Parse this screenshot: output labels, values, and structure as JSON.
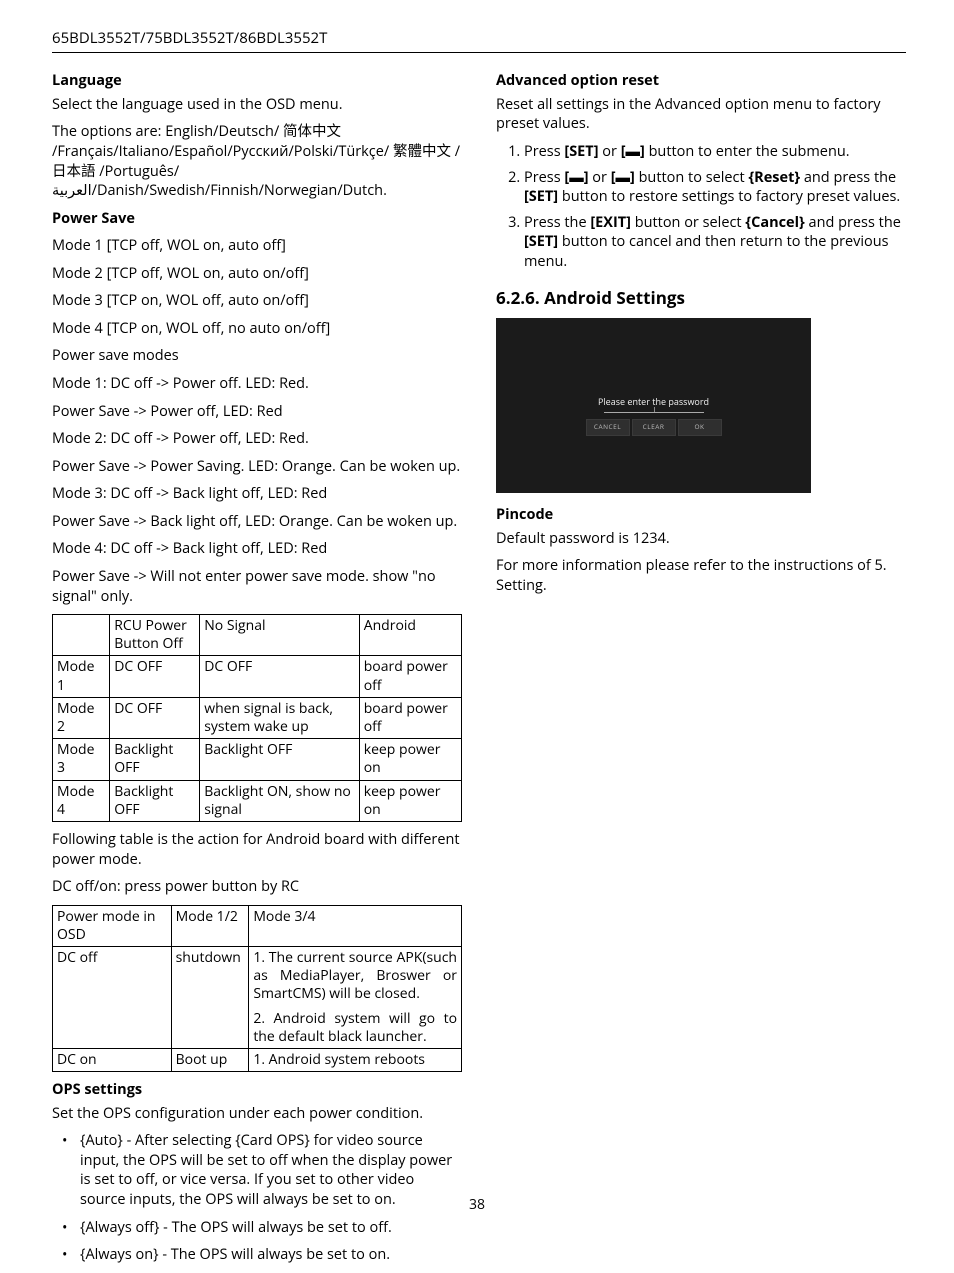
{
  "header": "65BDL3552T/75BDL3552T/86BDL3552T",
  "page_number": "38",
  "left": {
    "language_h": "Language",
    "language_p1": "Select the language used in the OSD menu.",
    "language_p2": "The options are: English/Deutsch/ 简体中文 /Français/Italiano/Español/Русский/Polski/Türkçe/ 繁體中文 / 日本語 /Português/ العربية/Danish/Swedish/Finnish/Norwegian/Dutch.",
    "powersave_h": "Power Save",
    "ps_lines": [
      "Mode 1 [TCP off, WOL on, auto off]",
      "Mode 2 [TCP off, WOL on, auto on/off]",
      "Mode 3 [TCP on, WOL off, auto on/off]",
      "Mode 4 [TCP on, WOL off, no auto on/off]",
      "Power save modes",
      "Mode 1:  DC off  -> Power off. LED: Red.",
      "Power Save -> Power off, LED: Red",
      "Mode 2:  DC off  -> Power off, LED: Red.",
      "Power Save -> Power Saving. LED: Orange. Can be woken up.",
      "Mode 3:  DC off  -> Back light off, LED: Red",
      "Power Save  -> Back light off, LED: Orange. Can be woken up.",
      "Mode 4:  DC off  -> Back light off, LED: Red",
      "Power Save  -> Will not enter power save mode. show \"no signal\" only."
    ],
    "table1": {
      "r0": [
        "",
        "RCU Power Button Off",
        "No Signal",
        "Android"
      ],
      "r1": [
        "Mode 1",
        "DC OFF",
        "DC OFF",
        "board power off"
      ],
      "r2": [
        "Mode 2",
        "DC OFF",
        "when signal is back, system wake up",
        "board power off"
      ],
      "r3": [
        "Mode 3",
        "Backlight OFF",
        "Backlight OFF",
        "keep power on"
      ],
      "r4": [
        "Mode 4",
        "Backlight OFF",
        "Backlight ON, show no signal",
        "keep power on"
      ]
    },
    "android_note_p1": "Following table is the action for Android board with different power mode.",
    "android_note_p2": "DC off/on: press power button by RC",
    "table2": {
      "r0": [
        "Power mode in OSD",
        "Mode 1/2",
        "Mode 3/4"
      ],
      "r1c0": "DC off",
      "r1c1": "shutdown",
      "r1c2a": "1. The current source APK(such as MediaPlayer, Broswer or SmartCMS) will be closed.",
      "r1c2b": "2. Android system will go to the default black launcher.",
      "r2": [
        "DC on",
        "Boot up",
        "1. Android system reboots"
      ]
    },
    "ops_h": "OPS settings",
    "ops_p1": "Set the OPS configuration under each power condition.",
    "ops_items": [
      "{Auto} - After selecting {Card OPS} for video source input, the OPS will be set to off when the display power is set to off, or vice versa. If you set to other video source inputs, the OPS will always be set to on.",
      "{Always off} - The OPS will always be set to off.",
      "{Always on} - The OPS will always be set to on."
    ]
  },
  "right": {
    "adv_h": "Advanced option reset",
    "adv_p1": "Reset all settings in the Advanced option menu to factory preset values.",
    "adv_li1_a": "Press ",
    "adv_li1_b": "[SET]",
    "adv_li1_c": " or ",
    "adv_li1_d": "[▬]",
    "adv_li1_e": " button to enter the submenu.",
    "adv_li2_a": "Press ",
    "adv_li2_b": "[▬]",
    "adv_li2_c": " or ",
    "adv_li2_d": "[▬]",
    "adv_li2_e": " button to select ",
    "adv_li2_f": "{Reset}",
    "adv_li2_g": " and press the ",
    "adv_li2_h": "[SET]",
    "adv_li2_i": " button to restore settings to factory preset values.",
    "adv_li3_a": "Press the ",
    "adv_li3_b": "[EXIT]",
    "adv_li3_c": " button or select ",
    "adv_li3_d": "{Cancel}",
    "adv_li3_e": " and press the ",
    "adv_li3_f": "[SET]",
    "adv_li3_g": " button to cancel and then return to the previous menu.",
    "android_heading": "6.2.6. Android Settings",
    "shot_prompt": "Please enter the password",
    "btn_cancel": "CANCEL",
    "btn_clear": "CLEAR",
    "btn_ok": "OK",
    "pincode_h": "Pincode",
    "pincode_p1": "Default password is 1234.",
    "pincode_p2": "For more information please refer to the instructions of 5. Setting."
  }
}
